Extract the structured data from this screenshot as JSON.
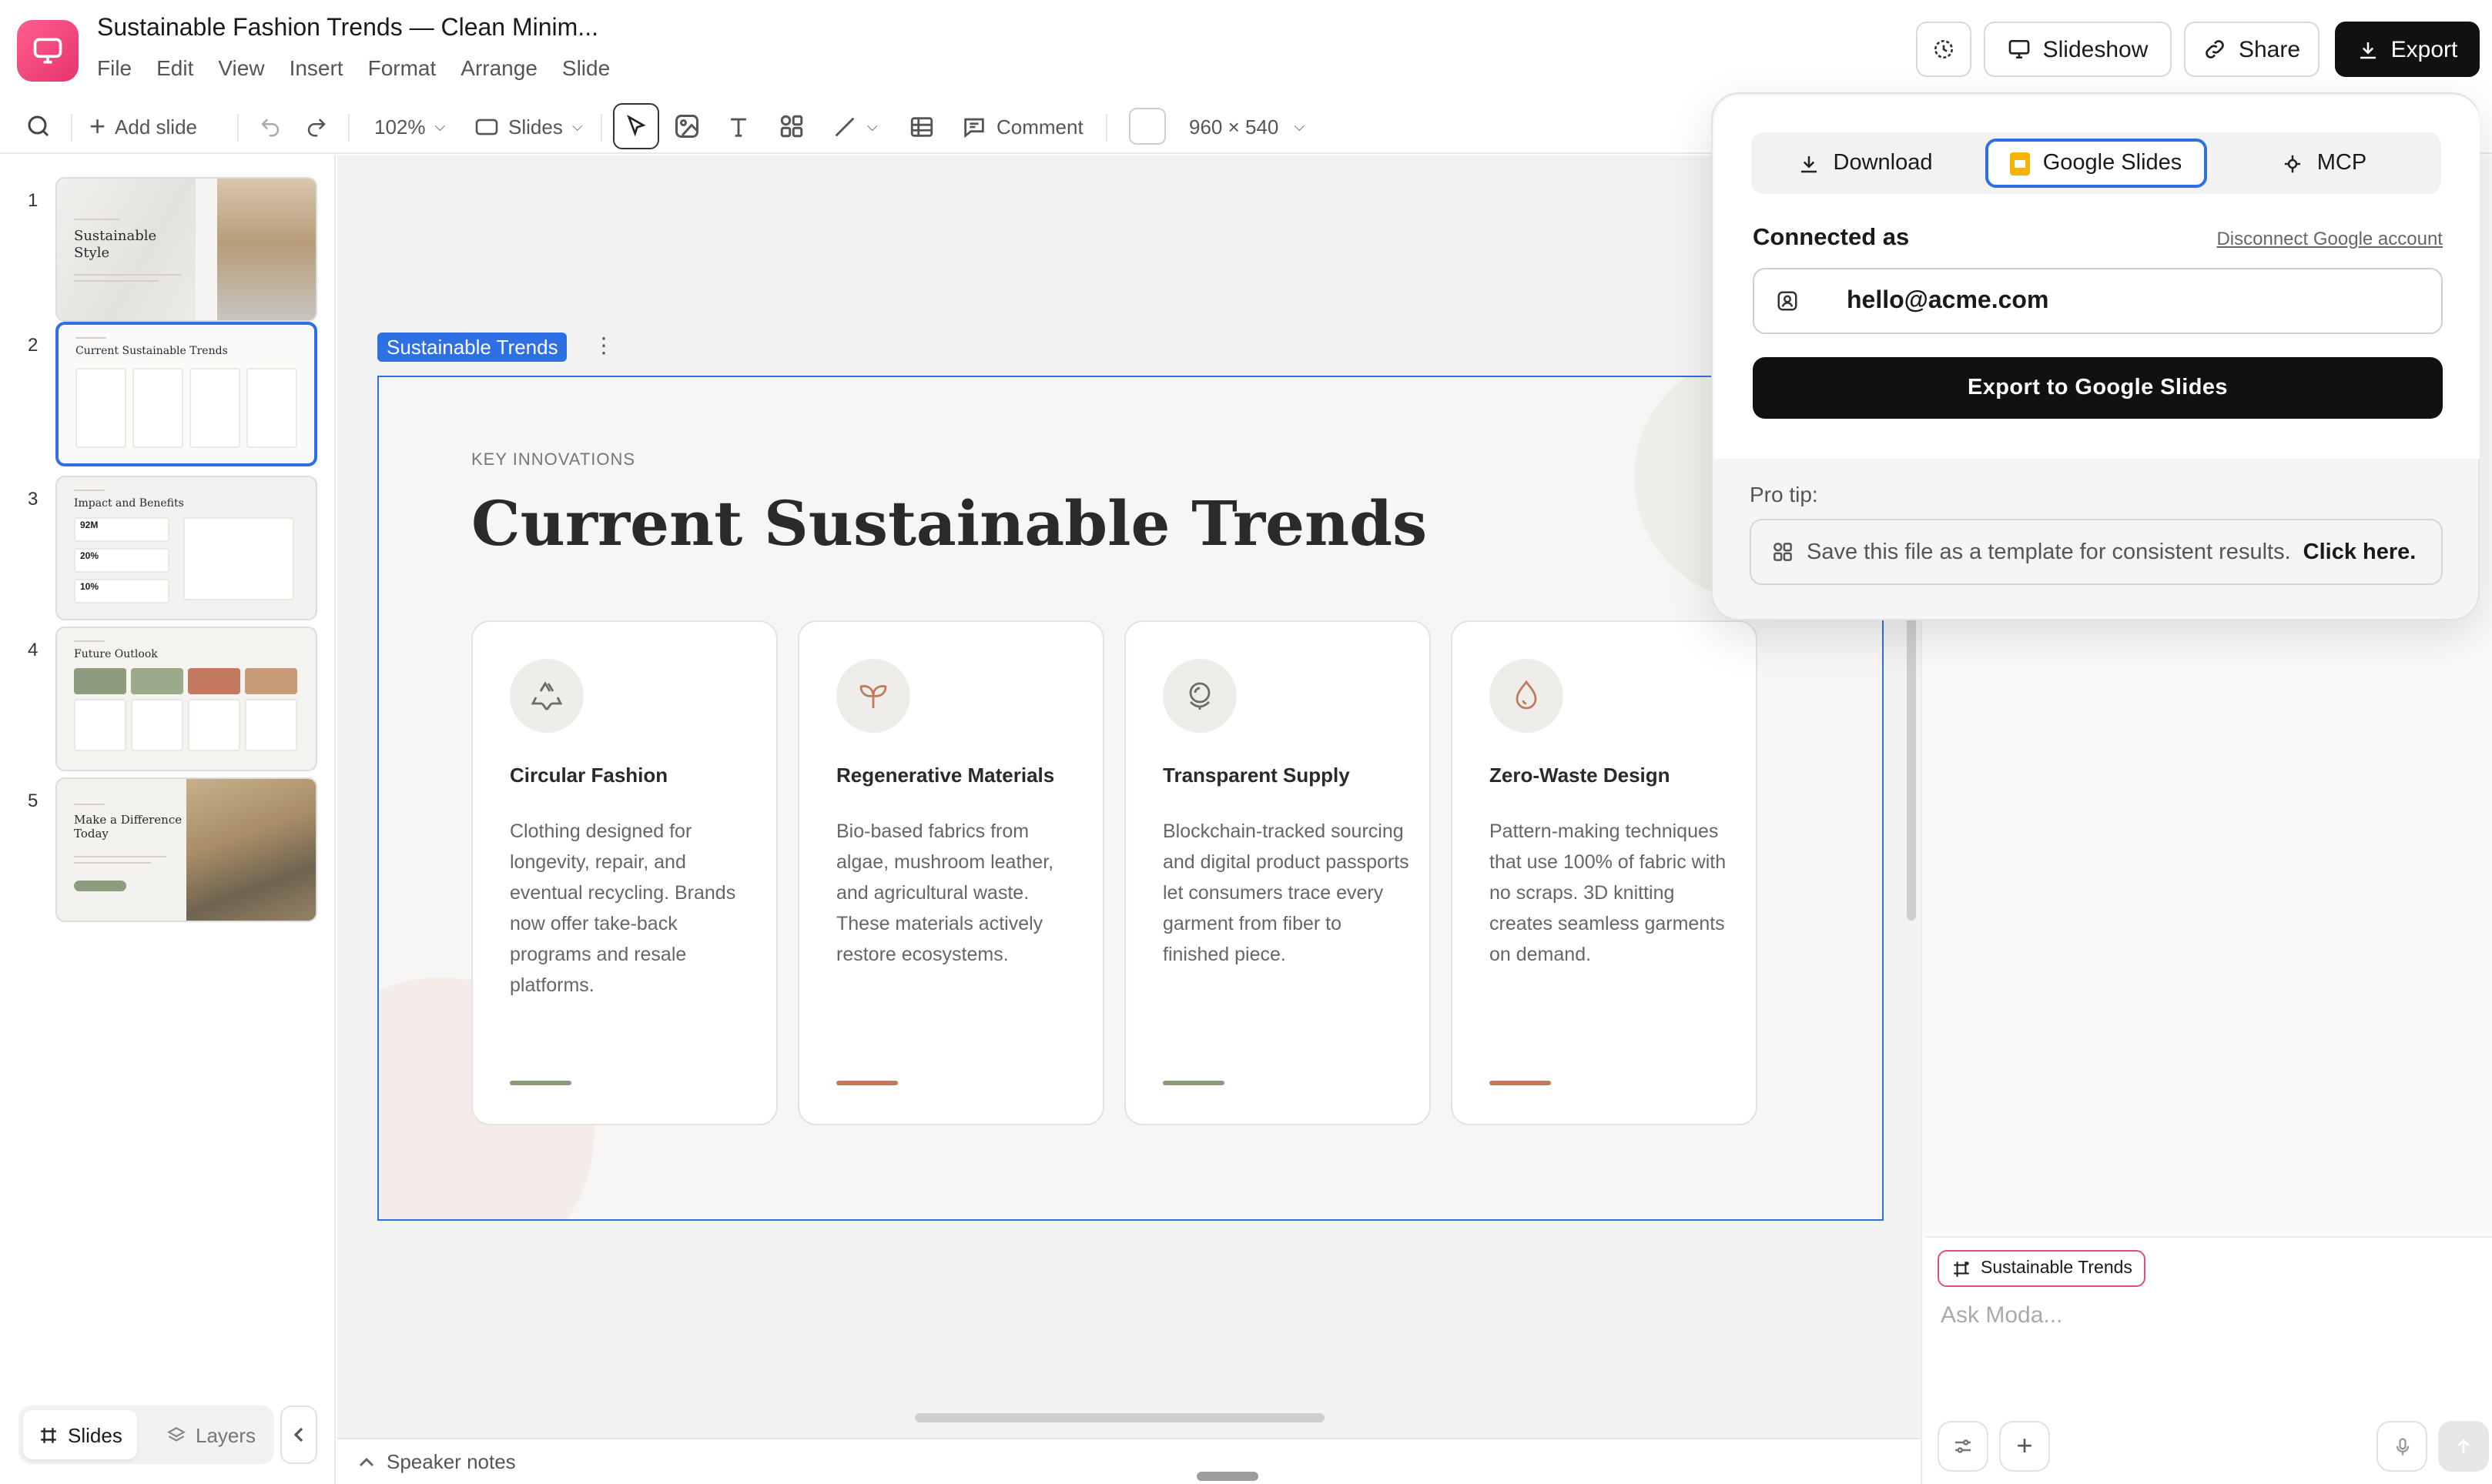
{
  "header": {
    "doc_title": "Sustainable Fashion Trends — Clean Minim...",
    "menus": [
      "File",
      "Edit",
      "View",
      "Insert",
      "Format",
      "Arrange",
      "Slide"
    ],
    "slideshow_label": "Slideshow",
    "share_label": "Share",
    "export_label": "Export"
  },
  "toolbar": {
    "add_slide_label": "Add slide",
    "zoom": "102%",
    "slides_dropdown": "Slides",
    "comment_label": "Comment",
    "canvas_size": "960 × 540"
  },
  "sidebar": {
    "thumbnails": [
      {
        "num": "1",
        "title": "Sustainable Style"
      },
      {
        "num": "2",
        "title": "Current Sustainable Trends"
      },
      {
        "num": "3",
        "title": "Impact and Benefits",
        "stats": [
          "92M",
          "20%",
          "10%"
        ]
      },
      {
        "num": "4",
        "title": "Future Outlook"
      },
      {
        "num": "5",
        "title": "Make a Difference Today"
      }
    ],
    "tabs": {
      "slides": "Slides",
      "layers": "Layers"
    }
  },
  "canvas": {
    "slide_label": "Sustainable Trends",
    "eyebrow": "KEY INNOVATIONS",
    "title": "Current Sustainable Trends",
    "cards": [
      {
        "icon": "recycle-icon",
        "title": "Circular Fashion",
        "body": "Clothing designed for longevity, repair, and eventual recycling. Brands now offer take-back programs and resale platforms.",
        "accent": "#8a9a7b"
      },
      {
        "icon": "sprout-icon",
        "title": "Regenerative Materials",
        "body": "Bio-based fabrics from algae, mushroom leather, and agricultural waste. These materials actively restore ecosystems.",
        "accent": "#c27a5c"
      },
      {
        "icon": "globe-icon",
        "title": "Transparent Supply",
        "body": "Blockchain-tracked sourcing and digital product passports let consumers trace every garment from fiber to finished piece.",
        "accent": "#8a9a7b"
      },
      {
        "icon": "droplet-icon",
        "title": "Zero-Waste Design",
        "body": "Pattern-making techniques that use 100% of fabric with no scraps. 3D knitting creates seamless garments on demand.",
        "accent": "#c27a5c"
      }
    ]
  },
  "notes": {
    "label": "Speaker notes"
  },
  "chat": {
    "chip_label": "Sustainable Trends",
    "placeholder": "Ask Moda..."
  },
  "export_popover": {
    "tabs": [
      "Download",
      "Google Slides",
      "MCP"
    ],
    "active_tab": "Google Slides",
    "connected_label": "Connected as",
    "disconnect_label": "Disconnect Google account",
    "account_email": "hello@acme.com",
    "export_button": "Export to Google Slides",
    "pro_tip_label": "Pro tip:",
    "pro_tip_text": "Save this file as a template for consistent results.",
    "pro_tip_link": "Click here."
  },
  "colors": {
    "accent_blue": "#2f6fe4",
    "brand_pink": "#e8336d",
    "sage": "#8a9a7b",
    "terracotta": "#c27a5c"
  }
}
